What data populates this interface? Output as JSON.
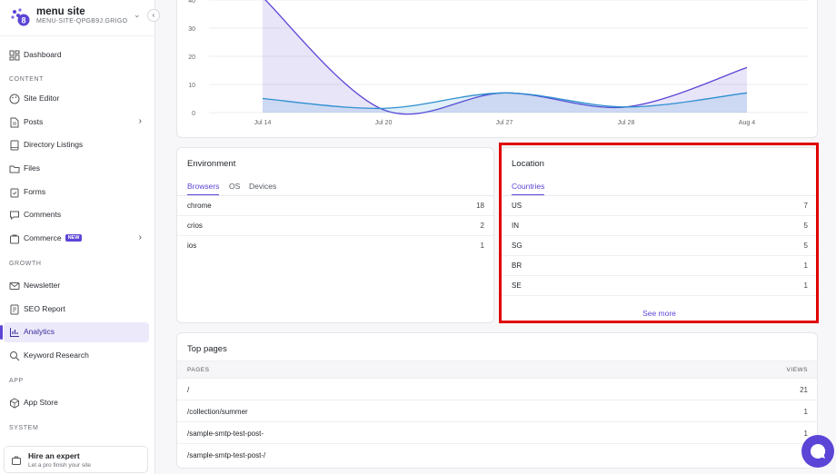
{
  "site": {
    "name": "menu site",
    "subdomain": "MENU-SITE-QPGB9J.GRIGOR..."
  },
  "sidebar": {
    "items": [
      {
        "label": "Dashboard",
        "icon": "dashboard-icon"
      },
      {
        "label": "Site Editor",
        "icon": "palette-icon"
      },
      {
        "label": "Posts",
        "icon": "document-icon"
      },
      {
        "label": "Directory Listings",
        "icon": "book-icon"
      },
      {
        "label": "Files",
        "icon": "folder-icon"
      },
      {
        "label": "Forms",
        "icon": "clipboard-icon"
      },
      {
        "label": "Comments",
        "icon": "comment-icon"
      },
      {
        "label": "Commerce",
        "icon": "bag-icon",
        "badge": "NEW"
      },
      {
        "label": "Newsletter",
        "icon": "mail-icon"
      },
      {
        "label": "SEO Report",
        "icon": "report-icon"
      },
      {
        "label": "Analytics",
        "icon": "chart-icon"
      },
      {
        "label": "Keyword Research",
        "icon": "search-icon"
      },
      {
        "label": "App Store",
        "icon": "box-icon"
      }
    ],
    "sections": {
      "content": "CONTENT",
      "growth": "GROWTH",
      "app": "APP",
      "system": "SYSTEM"
    },
    "expert": {
      "title": "Hire an expert",
      "subtitle": "Let a pro finish your site"
    }
  },
  "chart_data": {
    "type": "area",
    "categories": [
      "Jul 14",
      "Jul 20",
      "Jul 27",
      "Jul 28",
      "Aug 4"
    ],
    "yticks": [
      "40",
      "30",
      "20",
      "10",
      "0"
    ],
    "ylim": [
      0,
      40
    ],
    "series": [
      {
        "values": [
          41,
          1,
          7,
          2,
          16
        ],
        "color": "#5b45d6"
      },
      {
        "values": [
          5,
          1.5,
          7,
          2,
          7
        ],
        "color": "#2d8fd0"
      }
    ]
  },
  "environment": {
    "title": "Environment",
    "tabs": [
      "Browsers",
      "OS",
      "Devices"
    ],
    "rows": [
      {
        "label": "chrome",
        "value": "18"
      },
      {
        "label": "crios",
        "value": "2"
      },
      {
        "label": "ios",
        "value": "1"
      }
    ]
  },
  "location": {
    "title": "Location",
    "tabs": [
      "Countries"
    ],
    "rows": [
      {
        "label": "US",
        "value": "7"
      },
      {
        "label": "IN",
        "value": "5"
      },
      {
        "label": "SG",
        "value": "5"
      },
      {
        "label": "BR",
        "value": "1"
      },
      {
        "label": "SE",
        "value": "1"
      }
    ],
    "see_more": "See more"
  },
  "top_pages": {
    "title": "Top pages",
    "header": {
      "pages": "PAGES",
      "views": "VIEWS"
    },
    "rows": [
      {
        "page": "/",
        "views": "21"
      },
      {
        "page": "/collection/summer",
        "views": "1"
      },
      {
        "page": "/sample-smtp-test-post-",
        "views": "1"
      },
      {
        "page": "/sample-smtp-test-post-/",
        "views": "1"
      }
    ]
  },
  "colors": {
    "accent": "#5b45d6",
    "highlight": "#e00000"
  }
}
